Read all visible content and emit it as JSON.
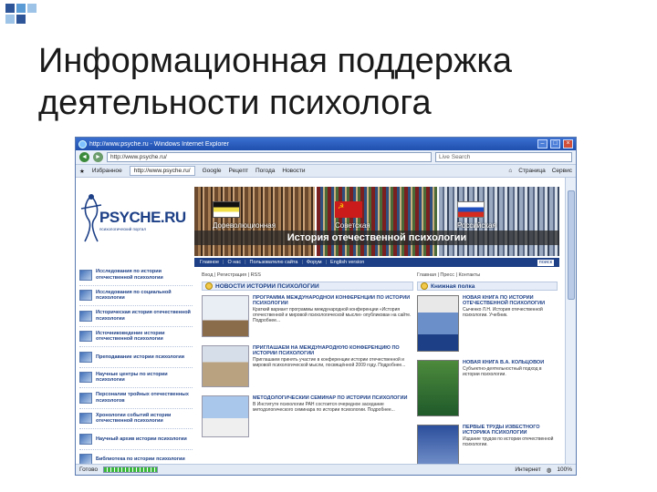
{
  "slide": {
    "title_line1": "Информационная поддержка",
    "title_line2": "деятельности психолога",
    "accent_colors": [
      "#5b9bd5",
      "#9dc3e6",
      "#2e5597"
    ]
  },
  "browser": {
    "window_title": "http://www.psyche.ru - Windows Internet Explorer",
    "address": "http://www.psyche.ru/",
    "search_placeholder": "Live Search",
    "tab_label": "http://www.psyche.ru/",
    "links": [
      "Избранное",
      "Google",
      "Рецепт",
      "Погода",
      "Новости"
    ],
    "right_tools": [
      "Страница",
      "Сервис"
    ],
    "status_text": "Готово",
    "zone_text": "Интернет",
    "zoom": "100%"
  },
  "site": {
    "brand": "PSYCHE.RU",
    "tagline": "психологический портал",
    "banner_panels": [
      "Дореволюционная",
      "Советская",
      "Российская"
    ],
    "banner_title": "История отечественной психологии",
    "nav": [
      "Главное",
      "О нас",
      "Пользователю сайта",
      "Форум",
      "English version"
    ],
    "search_button": "поиск",
    "left_menu": [
      "Исследования по истории отечественной психологии",
      "Исследования по социальной психологии",
      "Историческая история отечественной психологии",
      "Источниковедение истории отечественной психологии",
      "Преподавание истории психологии",
      "Научные центры по истории психологии",
      "Персоналии тройных отечественных психологов",
      "Хронологии событий истории отечественной психологии",
      "Научный архив истории психологии",
      "Библиотека по истории психологии"
    ],
    "news_meta": "Вход | Регистрация | RSS",
    "news_heading": "НОВОСТИ ИСТОРИИ ПСИХОЛОГИИ",
    "news": [
      {
        "title": "ПРОГРАММА МЕЖДУНАРОДНОЙ КОНФЕРЕНЦИИ ПО ИСТОРИИ ПСИХОЛОГИИ",
        "text": "Краткий вариант программы международной конференции «История отечественной и мировой психологической мысли» опубликован на сайте. Подробнее..."
      },
      {
        "title": "ПРИГЛАШАЕМ НА МЕЖДУНАРОДНУЮ КОНФЕРЕНЦИЮ ПО ИСТОРИИ ПСИХОЛОГИИ",
        "text": "Приглашаем принять участие в конференции истории отечественной и мировой психологической мысли, посвящённой 2009 году. Подробнее..."
      },
      {
        "title": "МЕТОДОЛОГИЧЕСКИЙ СЕМИНАР ПО ИСТОРИИ ПСИХОЛОГИИ",
        "text": "В Институте психологии РАН состоится очередное заседание методологического семинара по истории психологии. Подробнее..."
      }
    ],
    "books_meta": "Главная | Пресс | Контакты",
    "books_heading": "Книжная полка",
    "books": [
      {
        "title": "НОВАЯ КНИГА ПО ИСТОРИИ ОТЕЧЕСТВЕННОЙ ПСИХОЛОГИИ",
        "text": "Сыченко Л.Н. История отечественной психологии. Учебник."
      },
      {
        "title": "НОВАЯ КНИГА В.А. КОЛЬЦОВОЙ",
        "text": "Субъектно-деятельностный подход в истории психологии."
      },
      {
        "title": "ПЕРВЫЕ ТРУДЫ ИЗВЕСТНОГО ИСТОРИКА ПСИХОЛОГИИ",
        "text": "Издание трудов по истории отечественной психологии."
      }
    ]
  }
}
